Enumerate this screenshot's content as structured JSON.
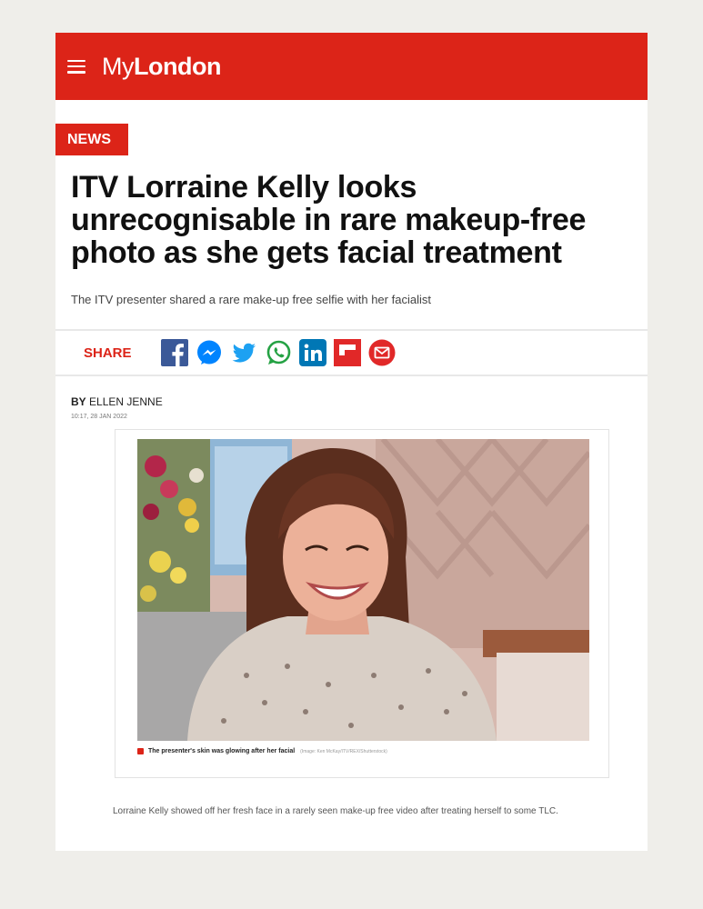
{
  "site": {
    "logo_my": "My",
    "logo_london": "London"
  },
  "article": {
    "section": "NEWS",
    "headline": "ITV Lorraine Kelly looks unrecognisable in rare makeup-free photo as she gets facial treatment",
    "standfirst": "The ITV presenter shared a rare make-up free selfie with her facialist",
    "share_label": "SHARE",
    "share_icons": [
      "facebook-icon",
      "messenger-icon",
      "twitter-icon",
      "whatsapp-icon",
      "linkedin-icon",
      "flipboard-icon",
      "email-icon"
    ],
    "byline_prefix": "BY",
    "author": "ELLEN JENNE",
    "date": "10:17, 28 JAN 2022",
    "image_caption": "The presenter's skin was glowing after her facial",
    "image_credit": "(Image: Ken McKay/ITV/REX/Shutterstock)",
    "body": "Lorraine Kelly showed off her fresh face in a rarely seen make-up free video after treating herself to some TLC."
  },
  "colors": {
    "brand": "#dc2418",
    "background": "#efeeea"
  }
}
